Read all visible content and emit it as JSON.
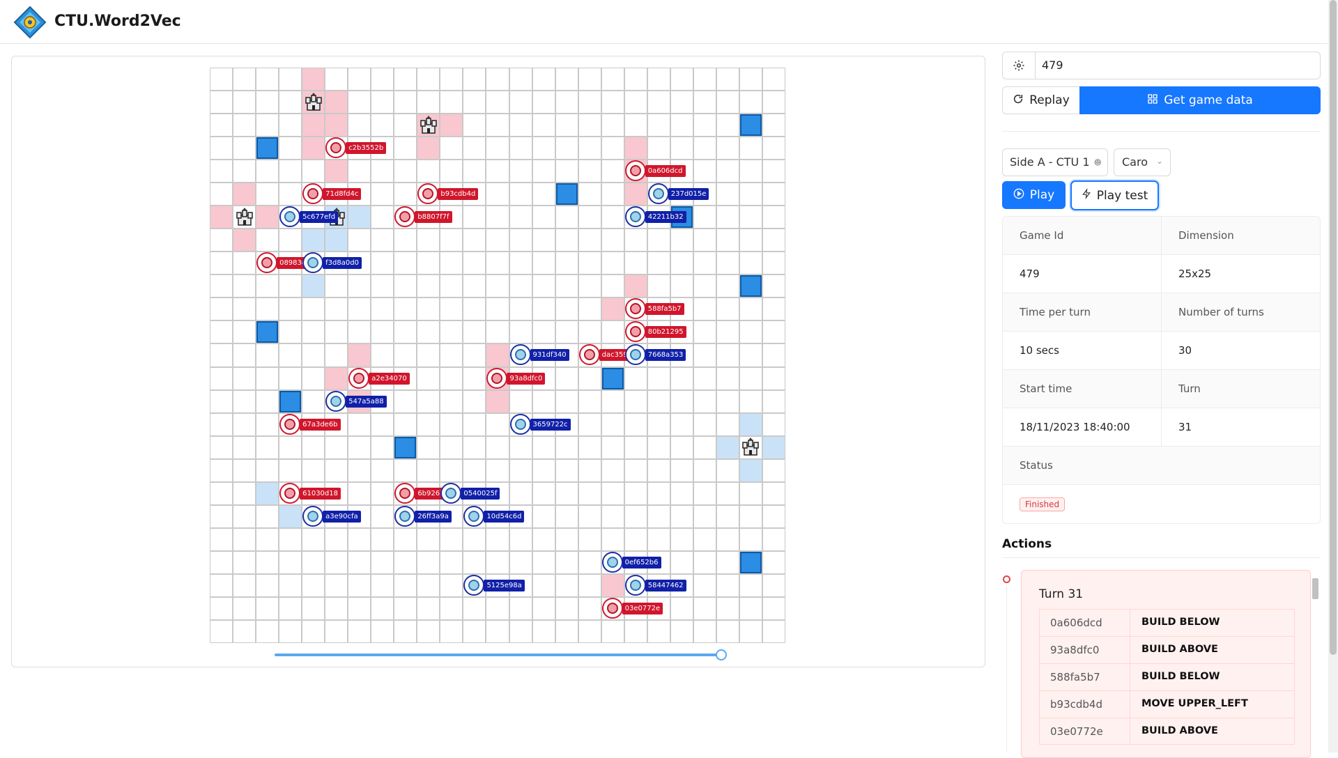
{
  "app": {
    "title": "CTU.Word2Vec"
  },
  "board": {
    "red_cells": [
      [
        4,
        0
      ],
      [
        4,
        1
      ],
      [
        5,
        1
      ],
      [
        4,
        2
      ],
      [
        5,
        2
      ],
      [
        9,
        2
      ],
      [
        10,
        2
      ],
      [
        9,
        3
      ],
      [
        4,
        3
      ],
      [
        18,
        3
      ],
      [
        5,
        4
      ],
      [
        18,
        4
      ],
      [
        1,
        5
      ],
      [
        18,
        5
      ],
      [
        0,
        6
      ],
      [
        2,
        6
      ],
      [
        1,
        7
      ],
      [
        18,
        9
      ],
      [
        17,
        10
      ],
      [
        6,
        12
      ],
      [
        12,
        12
      ],
      [
        5,
        13
      ],
      [
        12,
        13
      ],
      [
        6,
        14
      ],
      [
        12,
        14
      ],
      [
        17,
        22
      ]
    ],
    "blue_cells": [
      [
        5,
        6
      ],
      [
        6,
        6
      ],
      [
        4,
        7
      ],
      [
        5,
        7
      ],
      [
        4,
        9
      ],
      [
        23,
        15
      ],
      [
        22,
        16
      ],
      [
        24,
        16
      ],
      [
        23,
        17
      ],
      [
        2,
        18
      ],
      [
        3,
        19
      ]
    ],
    "walls": [
      [
        23,
        2
      ],
      [
        2,
        3
      ],
      [
        15,
        5
      ],
      [
        20,
        6
      ],
      [
        23,
        9
      ],
      [
        2,
        11
      ],
      [
        17,
        13
      ],
      [
        3,
        14
      ],
      [
        8,
        16
      ],
      [
        23,
        21
      ]
    ],
    "castles": [
      [
        4,
        1
      ],
      [
        9,
        2
      ],
      [
        1,
        6
      ],
      [
        5,
        6
      ],
      [
        23,
        16
      ]
    ],
    "red_agents": [
      {
        "x": 5,
        "y": 3,
        "label": "c2b3552b"
      },
      {
        "x": 18,
        "y": 4,
        "label": "0a606dcd"
      },
      {
        "x": 4,
        "y": 5,
        "label": "71d8fd4c"
      },
      {
        "x": 9,
        "y": 5,
        "label": "b93cdb4d"
      },
      {
        "x": 8,
        "y": 6,
        "label": "b8807f7f"
      },
      {
        "x": 2,
        "y": 8,
        "label": "08983d1d"
      },
      {
        "x": 18,
        "y": 10,
        "label": "588fa5b7"
      },
      {
        "x": 18,
        "y": 11,
        "label": "80b21295"
      },
      {
        "x": 16,
        "y": 12,
        "label": "dac3599a"
      },
      {
        "x": 6,
        "y": 13,
        "label": "a2e34070"
      },
      {
        "x": 12,
        "y": 13,
        "label": "93a8dfc0"
      },
      {
        "x": 3,
        "y": 15,
        "label": "67a3de6b"
      },
      {
        "x": 3,
        "y": 18,
        "label": "61030d18"
      },
      {
        "x": 8,
        "y": 18,
        "label": "6b9267f9"
      },
      {
        "x": 17,
        "y": 23,
        "label": "03e0772e"
      }
    ],
    "blue_agents": [
      {
        "x": 19,
        "y": 5,
        "label": "237d015e"
      },
      {
        "x": 3,
        "y": 6,
        "label": "5c677efd"
      },
      {
        "x": 18,
        "y": 6,
        "label": "42211b32"
      },
      {
        "x": 4,
        "y": 8,
        "label": "f3d8a0d0"
      },
      {
        "x": 13,
        "y": 12,
        "label": "931df340"
      },
      {
        "x": 18,
        "y": 12,
        "label": "7668a353"
      },
      {
        "x": 5,
        "y": 14,
        "label": "547a5a88"
      },
      {
        "x": 13,
        "y": 15,
        "label": "3659722c"
      },
      {
        "x": 10,
        "y": 18,
        "label": "0540025f"
      },
      {
        "x": 4,
        "y": 19,
        "label": "a3e90cfa"
      },
      {
        "x": 8,
        "y": 19,
        "label": "26ff3a9a"
      },
      {
        "x": 11,
        "y": 19,
        "label": "10d54c6d"
      },
      {
        "x": 17,
        "y": 21,
        "label": "0ef652b6"
      },
      {
        "x": 11,
        "y": 22,
        "label": "5125e98a"
      },
      {
        "x": 18,
        "y": 22,
        "label": "58447462"
      }
    ],
    "size": 25
  },
  "replay_progress": 1.0,
  "panel": {
    "game_input": "479",
    "replay_label": "Replay",
    "get_data_label": "Get game data",
    "side_select": "Side A - CTU 1",
    "mode_select": "Caro",
    "play_label": "Play",
    "play_test_label": "Play test"
  },
  "info": {
    "game_id_label": "Game Id",
    "game_id": "479",
    "dimension_label": "Dimension",
    "dimension": "25x25",
    "time_per_turn_label": "Time per turn",
    "time_per_turn": "10 secs",
    "num_turns_label": "Number of turns",
    "num_turns": "30",
    "start_time_label": "Start time",
    "start_time": "18/11/2023 18:40:00",
    "turn_label": "Turn",
    "turn": "31",
    "status_label": "Status",
    "status": "Finished"
  },
  "actions": {
    "title": "Actions",
    "turn_title": "Turn 31",
    "rows": [
      {
        "id": "0a606dcd",
        "action": "BUILD BELOW"
      },
      {
        "id": "93a8dfc0",
        "action": "BUILD ABOVE"
      },
      {
        "id": "588fa5b7",
        "action": "BUILD BELOW"
      },
      {
        "id": "b93cdb4d",
        "action": "MOVE UPPER_LEFT"
      },
      {
        "id": "03e0772e",
        "action": "BUILD ABOVE"
      }
    ]
  },
  "colors": {
    "primary": "#1677ff",
    "red_team": "#d0162c",
    "blue_team": "#1020a8",
    "wall": "#2b8de3"
  }
}
